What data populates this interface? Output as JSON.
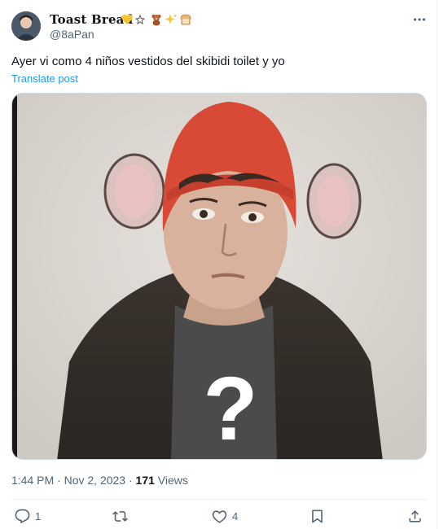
{
  "header": {
    "display_name": "Toast Bread",
    "handle": "@8aPan",
    "emojis": [
      "yellow-heart-icon",
      "star-icon",
      "teddy-bear-icon",
      "sparkles-icon",
      "bread-icon"
    ]
  },
  "tweet": {
    "text": "Ayer vi como 4 niños vestidos del skibidi toilet y yo",
    "translate_label": "Translate post"
  },
  "media": {
    "overlay_symbol": "?"
  },
  "meta": {
    "time": "1:44 PM",
    "separator": "·",
    "date": "Nov 2, 2023",
    "views_count": "171",
    "views_label": "Views"
  },
  "actions": {
    "reply_count": "1",
    "repost_count": "",
    "like_count": "4"
  },
  "colors": {
    "link": "#1d9bf0",
    "secondary_text": "#536471",
    "primary_text": "#0f1419"
  }
}
